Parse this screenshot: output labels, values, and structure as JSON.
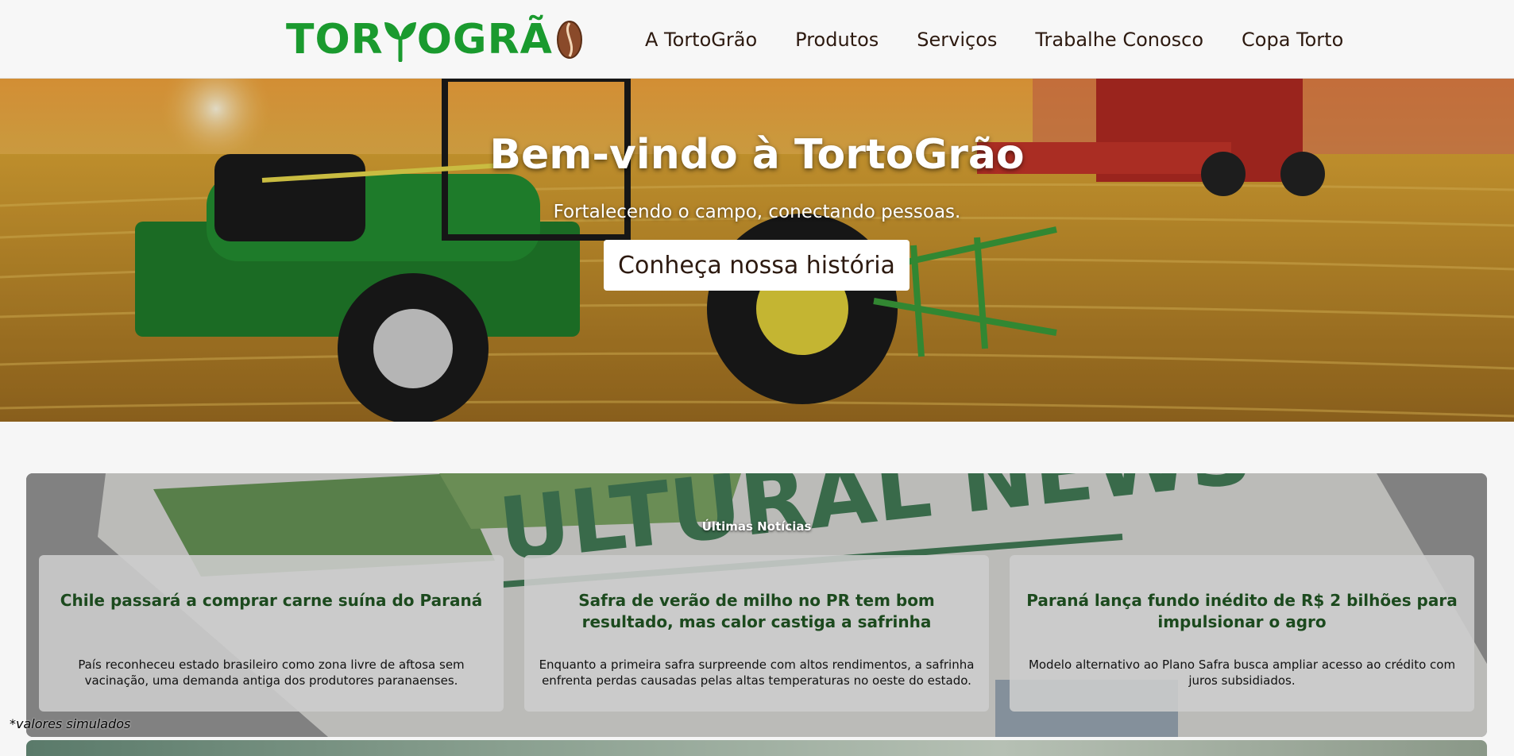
{
  "header": {
    "logo_text_left": "TOR",
    "logo_text_right": "OGRÃ",
    "logo_alt": "TortoGrão",
    "nav": [
      {
        "label": "A TortoGrão"
      },
      {
        "label": "Produtos"
      },
      {
        "label": "Serviços"
      },
      {
        "label": "Trabalhe Conosco"
      },
      {
        "label": "Copa Torto"
      }
    ]
  },
  "hero": {
    "title": "Bem-vindo à TortoGrão",
    "subtitle": "Fortalecendo o campo, conectando pessoas.",
    "button_label": "Conheça nossa história"
  },
  "news": {
    "heading": "Últimas Notícias",
    "background_headline": "ULTURAL NEWS",
    "cards": [
      {
        "title": "Chile passará a comprar carne suína do Paraná",
        "summary": "País reconheceu estado brasileiro como zona livre de aftosa sem vacinação, uma demanda antiga dos produtores paranaenses."
      },
      {
        "title": "Safra de verão de milho no PR tem bom resultado, mas calor castiga a safrinha",
        "summary": "Enquanto a primeira safra surpreende com altos rendimentos, a safrinha enfrenta perdas causadas pelas altas temperaturas no oeste do estado."
      },
      {
        "title": "Paraná lança fundo inédito de R$ 2 bilhões para impulsionar o agro",
        "summary": "Modelo alternativo ao Plano Safra busca ampliar acesso ao crédito com juros subsidiados."
      }
    ]
  },
  "footnote": "*valores simulados",
  "colors": {
    "brand_green": "#1a9a2e",
    "text_dark": "#2d1a10",
    "news_title": "#1c4a1e"
  }
}
